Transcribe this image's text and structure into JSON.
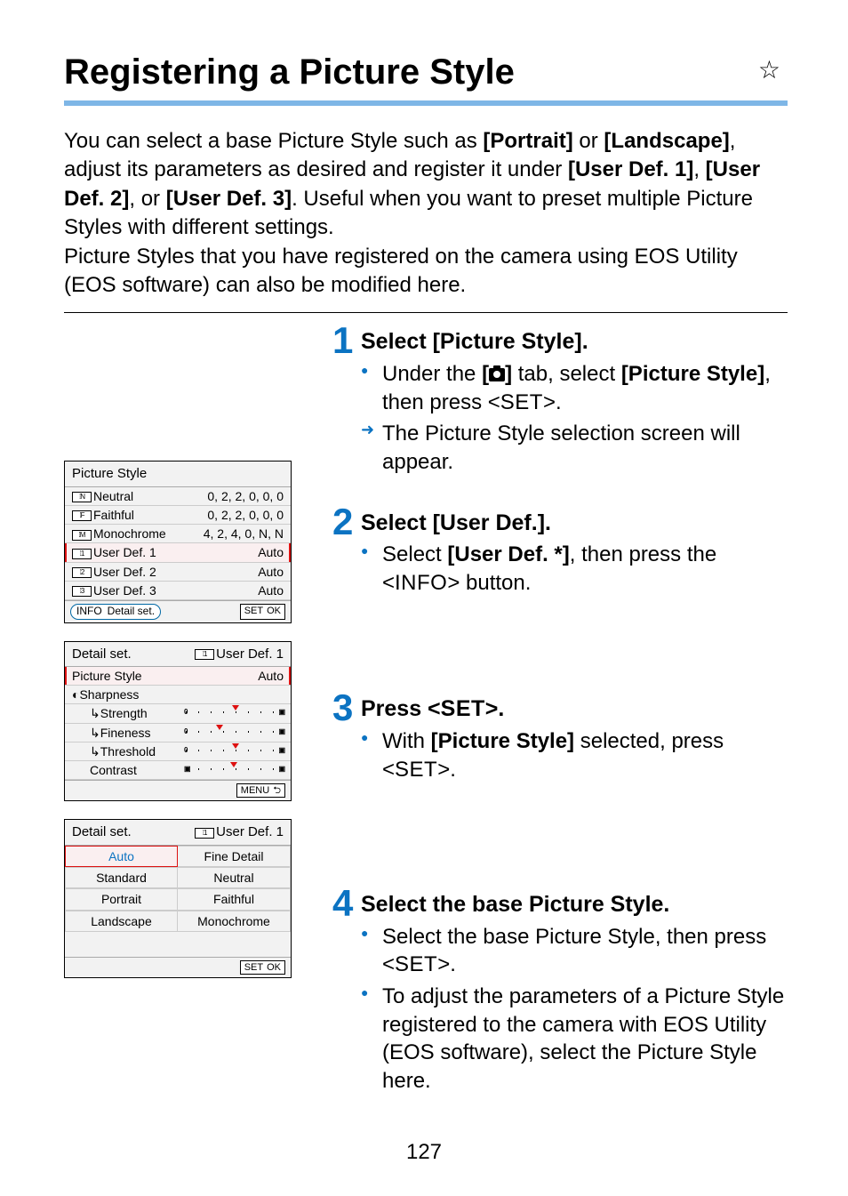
{
  "title": "Registering a Picture Style",
  "star_symbol": "☆",
  "intro": {
    "p1a": "You can select a base Picture Style such as ",
    "portrait": "[Portrait]",
    "p1b": " or ",
    "landscape": "[Landscape]",
    "p1c": ", adjust its parameters as desired and register it under ",
    "ud1": "[User Def. 1]",
    "comma": ", ",
    "ud2": "[User Def. 2]",
    "p1d": ", or ",
    "ud3": "[User Def. 3]",
    "p1e": ". Useful when you want to preset multiple Picture Styles with different settings.",
    "p2": "Picture Styles that you have registered on the camera using EOS Utility (EOS software) can also be modified here."
  },
  "steps": {
    "s1": {
      "num": "1",
      "title": "Select [Picture Style].",
      "b1a": "Under the ",
      "b1b": " tab, select ",
      "b1c": "[Picture Style]",
      "b1d": ", then press <",
      "set": "SET",
      "b1e": ">.",
      "b2": "The Picture Style selection screen will appear."
    },
    "s2": {
      "num": "2",
      "title": "Select [User Def.].",
      "b1a": "Select ",
      "b1b": "[User Def. *]",
      "b1c": ", then press the <",
      "info": "INFO",
      "b1d": "> button."
    },
    "s3": {
      "num": "3",
      "title_a": "Press <",
      "set": "SET",
      "title_b": ">.",
      "b1a": "With ",
      "b1b": "[Picture Style]",
      "b1c": " selected, press <",
      "b1d": ">."
    },
    "s4": {
      "num": "4",
      "title": "Select the base Picture Style.",
      "b1a": "Select the base Picture Style, then press <",
      "set": "SET",
      "b1b": ">.",
      "b2": "To adjust the parameters of a Picture Style registered to the camera with EOS Utility (EOS software), select the Picture Style here."
    }
  },
  "screen1": {
    "header": "Picture Style",
    "rows": [
      {
        "icon": "⁞N",
        "name": "Neutral",
        "val": "0, 2, 2, 0, 0, 0"
      },
      {
        "icon": "⁞F",
        "name": "Faithful",
        "val": "0, 2, 2, 0, 0, 0"
      },
      {
        "icon": "⁞M",
        "name": "Monochrome",
        "val": "4, 2, 4, 0, N, N"
      },
      {
        "icon": "⁞1",
        "name": "User Def. 1",
        "val": "Auto",
        "sel": true
      },
      {
        "icon": "⁞2",
        "name": "User Def. 2",
        "val": "Auto"
      },
      {
        "icon": "⁞3",
        "name": "User Def. 3",
        "val": "Auto"
      }
    ],
    "footer": {
      "info": "INFO",
      "detail": "Detail set.",
      "set": "SET",
      "ok": "OK"
    }
  },
  "screen2": {
    "header_l": "Detail set.",
    "header_r": "User Def. 1",
    "ps_label": "Picture Style",
    "ps_val": "Auto",
    "rows": [
      {
        "name": "Sharpness"
      },
      {
        "name": "Strength"
      },
      {
        "name": "Fineness"
      },
      {
        "name": "Threshold"
      },
      {
        "name": "Contrast"
      }
    ],
    "menu": "MENU"
  },
  "screen3": {
    "header_l": "Detail set.",
    "header_r": "User Def. 1",
    "options": [
      {
        "l": "Auto",
        "sel": true
      },
      {
        "l": "Fine Detail"
      },
      {
        "l": "Standard"
      },
      {
        "l": "Neutral"
      },
      {
        "l": "Portrait"
      },
      {
        "l": "Faithful"
      },
      {
        "l": "Landscape"
      },
      {
        "l": "Monochrome"
      }
    ],
    "set": "SET",
    "ok": "OK"
  },
  "page_number": "127"
}
